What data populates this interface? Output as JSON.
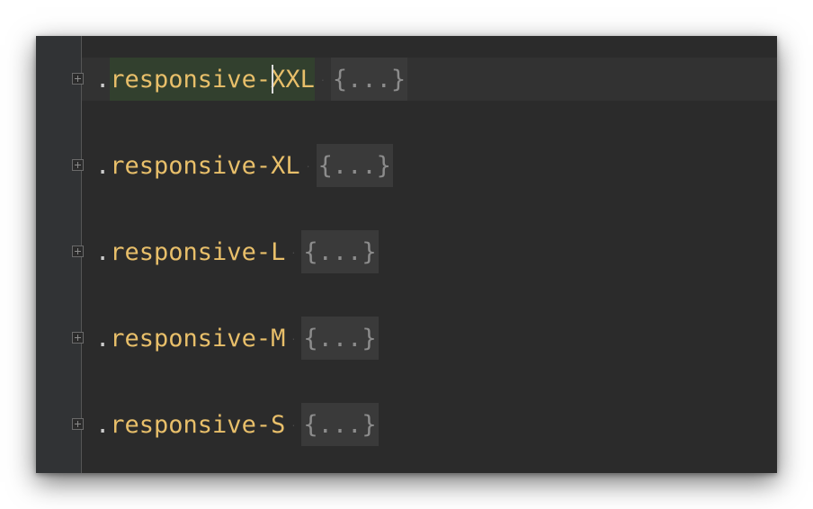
{
  "editor": {
    "lines": [
      {
        "dot": ".",
        "selector": "responsive-XXL",
        "separator": ".",
        "folded": "{...}"
      },
      {
        "dot": ".",
        "selector": "responsive-XL",
        "separator": ".",
        "folded": "{...}"
      },
      {
        "dot": ".",
        "selector": "responsive-L",
        "separator": ".",
        "folded": "{...}"
      },
      {
        "dot": ".",
        "selector": "responsive-M",
        "separator": ".",
        "folded": "{...}"
      },
      {
        "dot": ".",
        "selector": "responsive-S",
        "separator": ".",
        "folded": "{...}"
      }
    ],
    "colors": {
      "background": "#2b2b2b",
      "gutter": "#313335",
      "selector": "#e8bf6a",
      "folded_text": "#8c8c8c",
      "highlight": "#32402e"
    }
  }
}
